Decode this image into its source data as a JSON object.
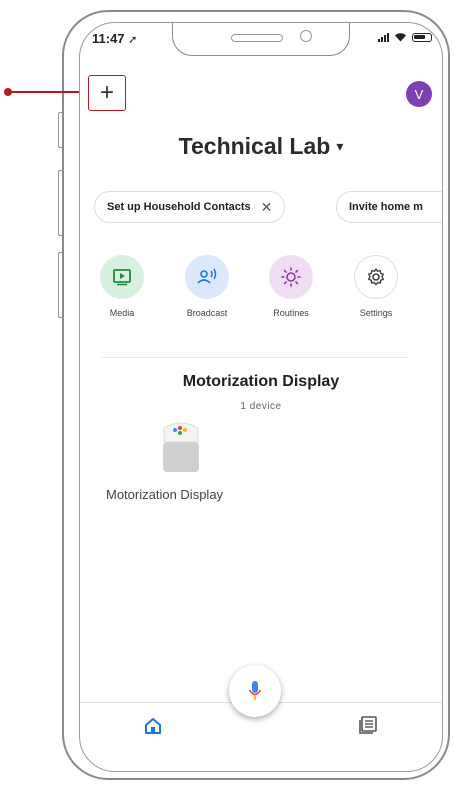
{
  "status_bar": {
    "time": "11:47"
  },
  "header": {
    "add_label": "+",
    "avatar_initial": "V"
  },
  "home": {
    "title": "Technical Lab",
    "caret": "▾"
  },
  "chips": [
    {
      "label": "Set up Household Contacts",
      "close": "✕"
    },
    {
      "label": "Invite home m"
    }
  ],
  "actions": [
    {
      "label": "Media",
      "icon": "media-icon",
      "color": "#d8f0df",
      "icon_color": "#1e8e3e"
    },
    {
      "label": "Broadcast",
      "icon": "broadcast-icon",
      "color": "#dbe9fb",
      "icon_color": "#1a73e8"
    },
    {
      "label": "Routines",
      "icon": "routines-icon",
      "color": "#f0ddf4",
      "icon_color": "#9334a6"
    },
    {
      "label": "Settings",
      "icon": "gear-icon",
      "color": "#ffffff",
      "icon_color": "#444444"
    }
  ],
  "room": {
    "title": "Motorization Display",
    "subtitle": "1 device"
  },
  "device": {
    "label": "Motorization Display",
    "icon": "smart-display-icon"
  },
  "bottom_nav": [
    {
      "icon": "home-icon",
      "color": "#1a73e8"
    },
    {
      "icon": "feed-icon",
      "color": "#555555"
    }
  ],
  "colors": {
    "highlight": "#b71c1c",
    "avatar": "#7e3fb5"
  }
}
